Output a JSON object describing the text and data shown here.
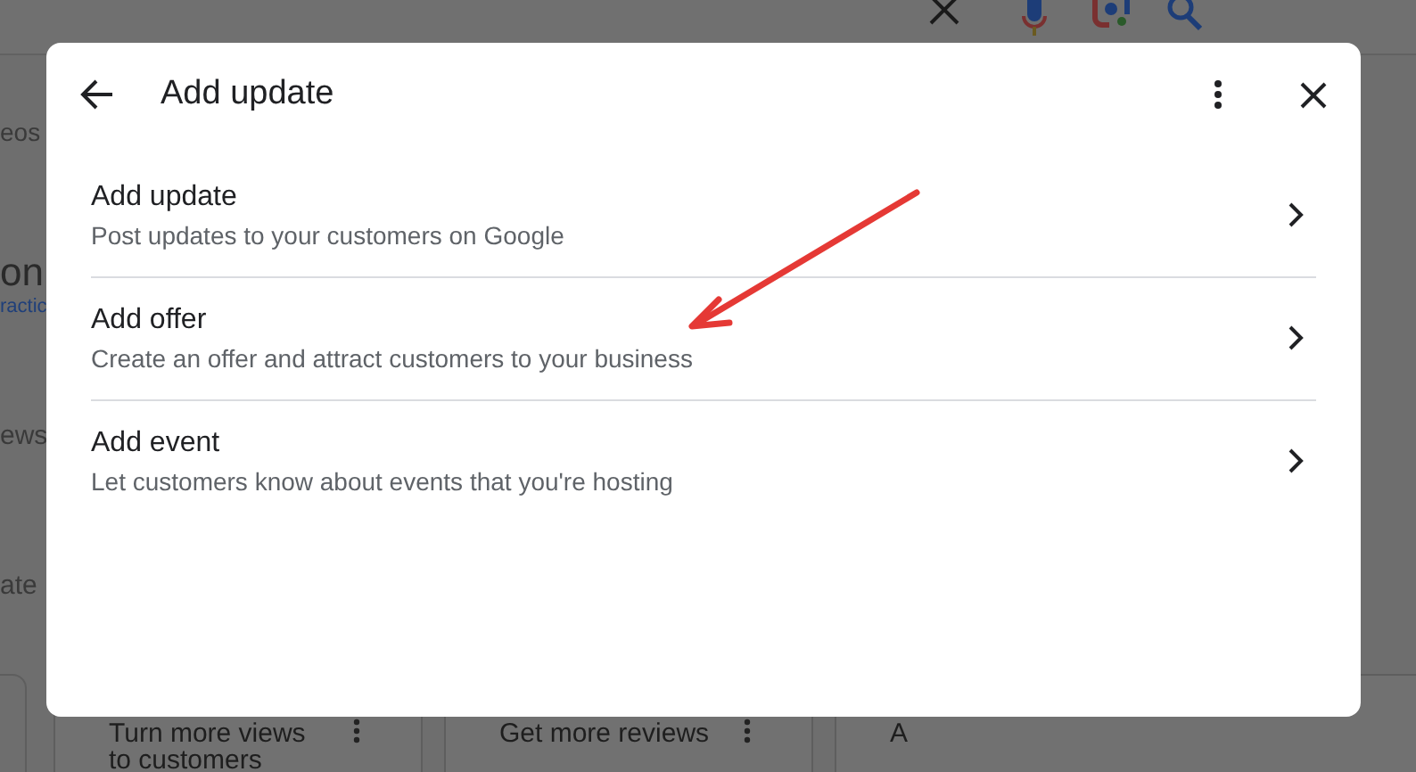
{
  "background": {
    "side_fragments": [
      "eos",
      "on",
      "ractic",
      "ews",
      "ate"
    ],
    "cards": [
      {
        "lines": [
          "Turn more views",
          "to customers"
        ],
        "menu": true
      },
      {
        "lines": [
          "Get more reviews"
        ],
        "menu": true
      },
      {
        "lines": [
          "A"
        ],
        "menu": false
      }
    ]
  },
  "dialog": {
    "title": "Add update",
    "options": [
      {
        "title": "Add update",
        "subtitle": "Post updates to your customers on Google"
      },
      {
        "title": "Add offer",
        "subtitle": "Create an offer and attract customers to your business"
      },
      {
        "title": "Add event",
        "subtitle": "Let customers know about events that you're hosting"
      }
    ]
  },
  "annotation": {
    "kind": "arrow",
    "color": "#e53935"
  }
}
